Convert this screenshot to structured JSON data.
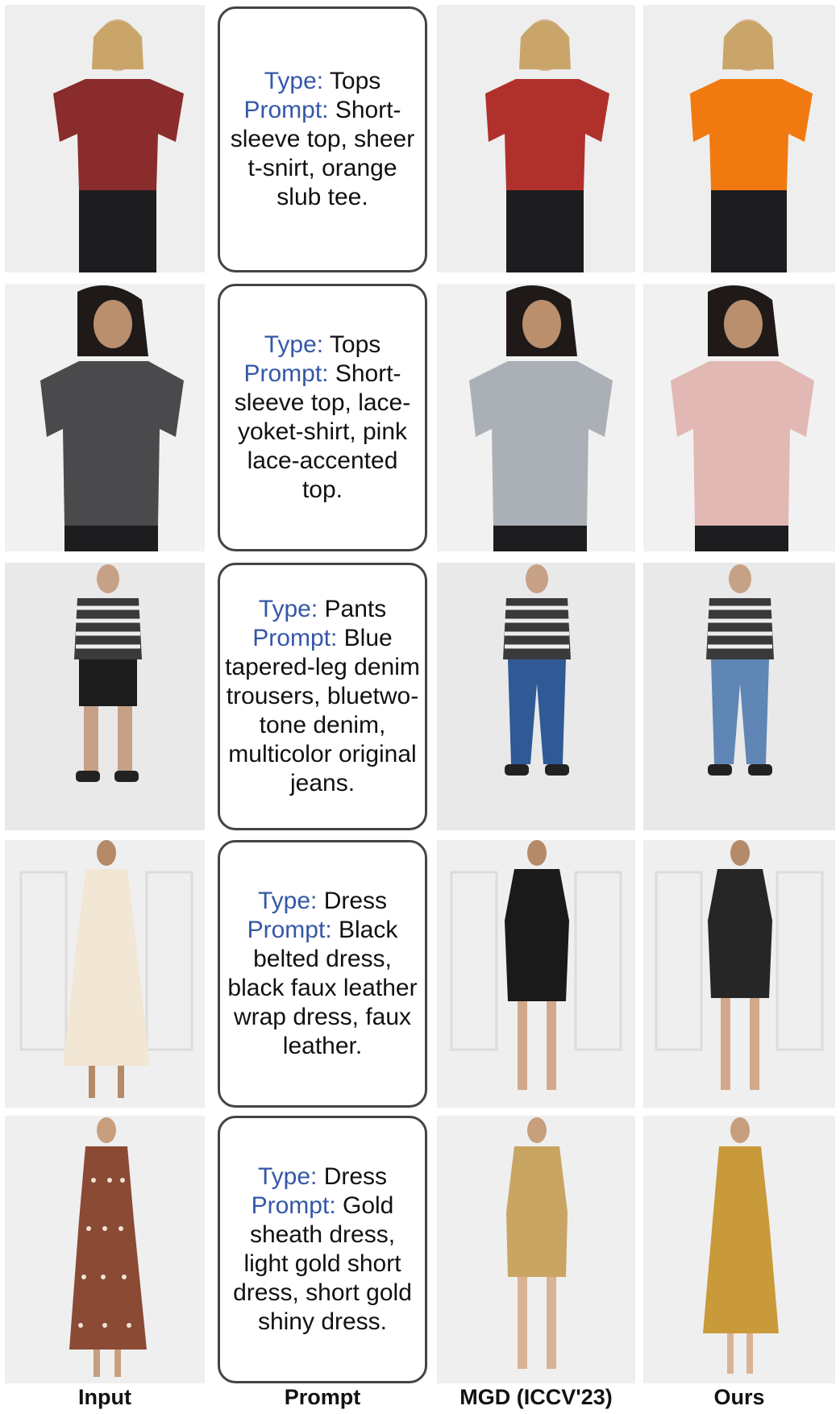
{
  "columns": {
    "input": "Input",
    "prompt": "Prompt",
    "mgd": "MGD (ICCV'23)",
    "ours": "Ours"
  },
  "rows": [
    {
      "type_label": "Type:",
      "type_value": "Tops",
      "prompt_label": "Prompt:",
      "prompt_value": "Short-sleeve top, sheer t-snirt, orange slub tee.",
      "colors": {
        "input": "#8a2b2c",
        "mgd": "#b0302c",
        "ours": "#f07a10",
        "bottom": "#1d1d1f"
      }
    },
    {
      "type_label": "Type:",
      "type_value": "Tops",
      "prompt_label": "Prompt:",
      "prompt_value": "Short-sleeve top, lace-yoket-shirt, pink lace-accented top.",
      "colors": {
        "input": "#4a4a4c",
        "mgd": "#aab0b6",
        "ours": "#e2b8b4",
        "bottom": "#1d1d1f"
      }
    },
    {
      "type_label": "Type:",
      "type_value": "Pants",
      "prompt_label": "Prompt:",
      "prompt_value": "Blue tapered-leg denim trousers, bluetwo-tone denim, multicolor original jeans.",
      "colors": {
        "input": "#1c1c1c",
        "mgd": "#2f5a96",
        "ours": "#5f86b4",
        "top": "#3a3a3c"
      }
    },
    {
      "type_label": "Type:",
      "type_value": "Dress",
      "prompt_label": "Prompt:",
      "prompt_value": "Black belted dress, black faux leather wrap dress, faux leather.",
      "colors": {
        "input": "#f2e6d4",
        "mgd": "#1a1a1a",
        "ours": "#262626"
      }
    },
    {
      "type_label": "Type:",
      "type_value": "Dress",
      "prompt_label": "Prompt:",
      "prompt_value": "Gold sheath dress, light gold short dress, short gold shiny dress.",
      "colors": {
        "input": "#8a4a34",
        "mgd": "#c9a563",
        "ours": "#c99a3a"
      }
    }
  ]
}
